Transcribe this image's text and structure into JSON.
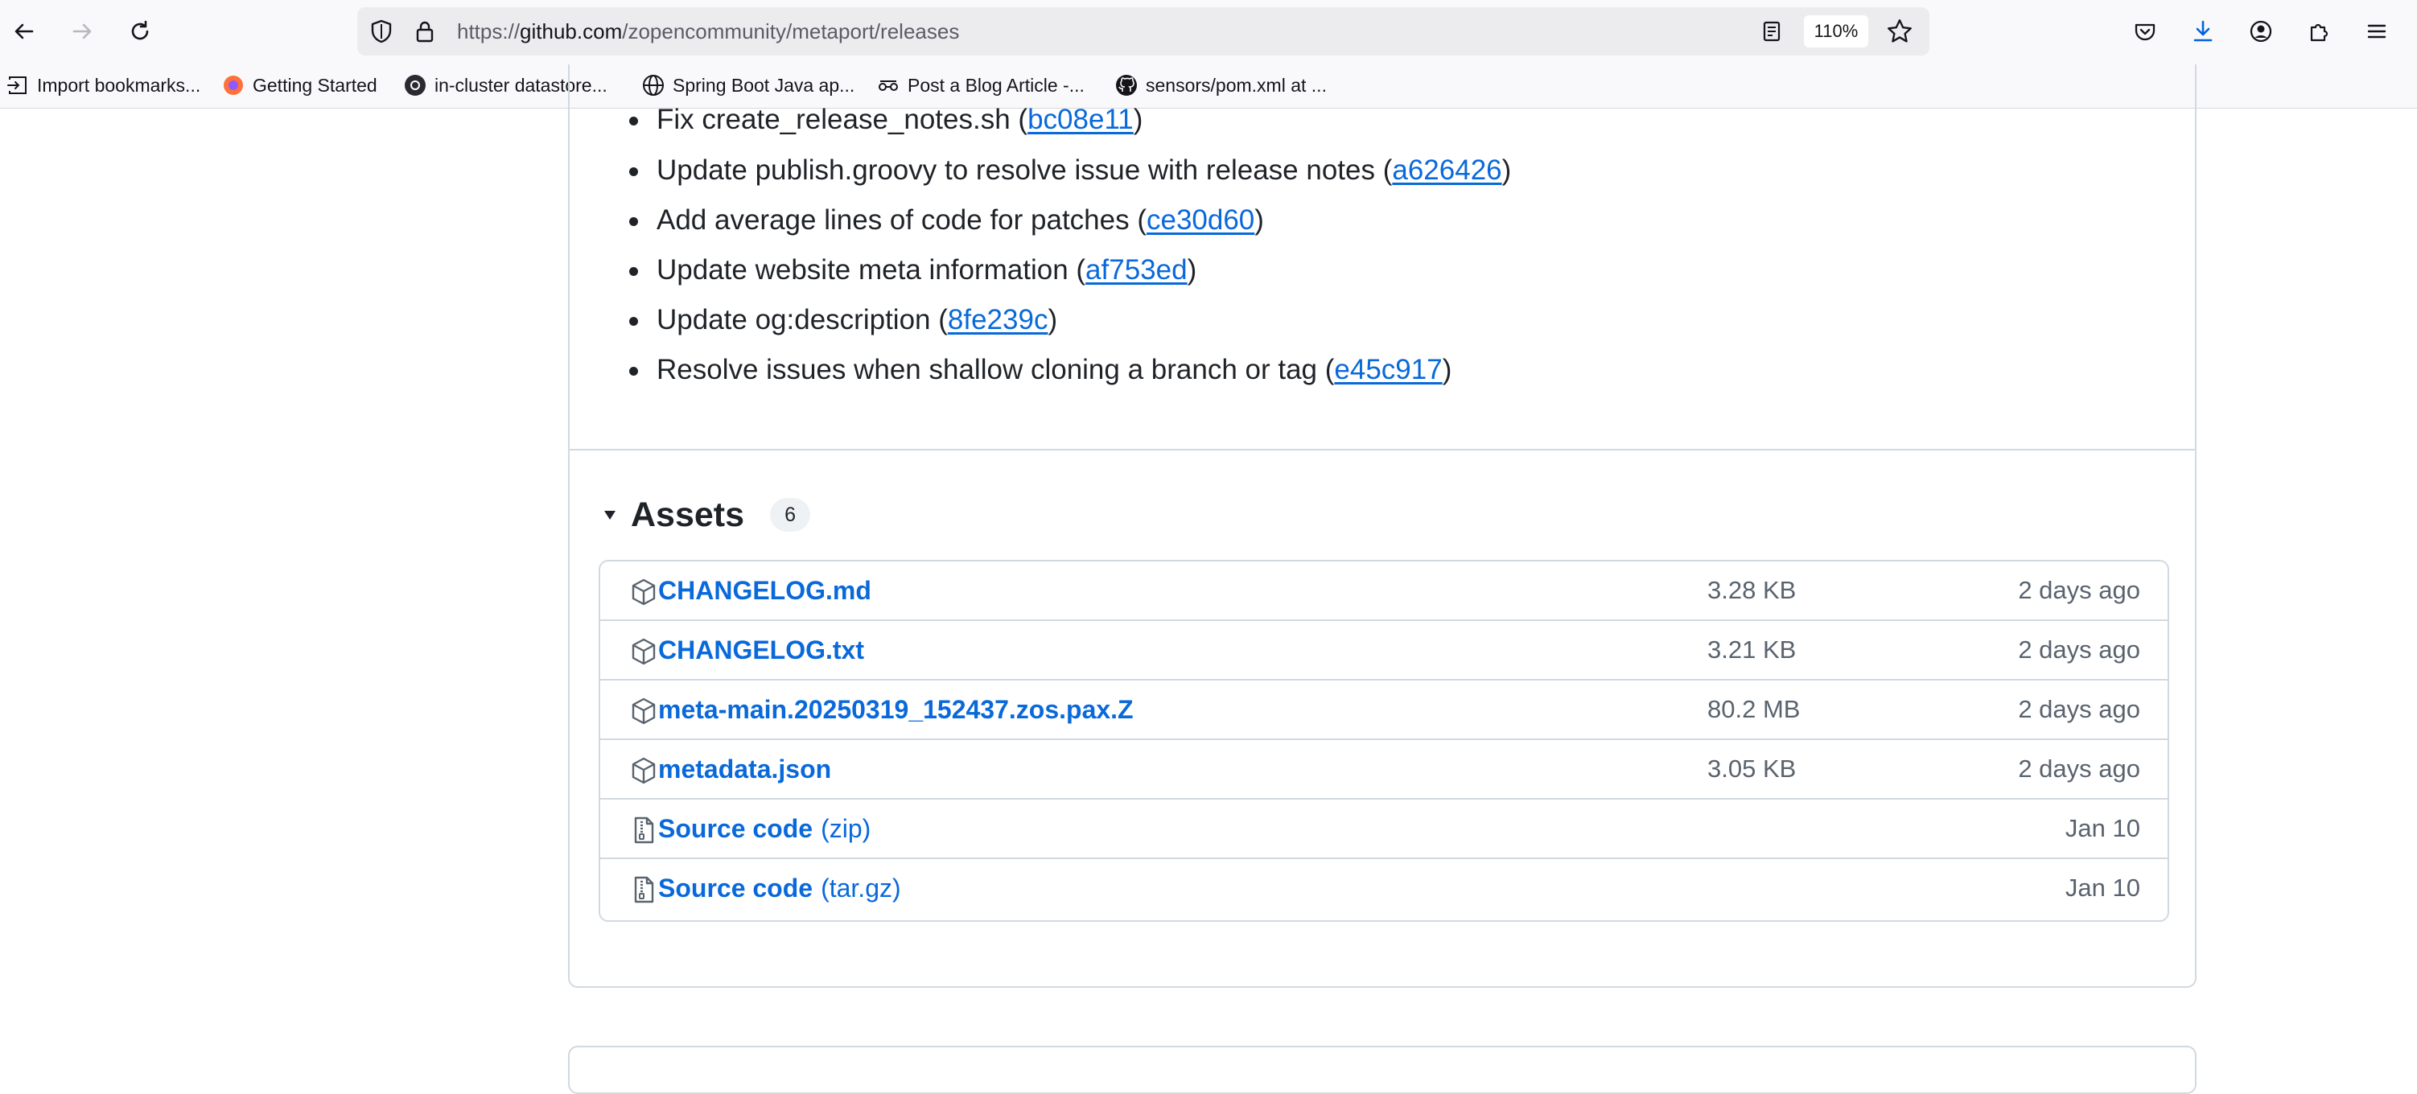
{
  "browser": {
    "url_prefix": "https://",
    "url_domain": "github.com",
    "url_path": "/zopencommunity/metaport/releases",
    "zoom": "110%"
  },
  "bookmarks": [
    {
      "label": "Import bookmarks...",
      "icon": "import-icon"
    },
    {
      "label": "Getting Started",
      "icon": "firefox-icon"
    },
    {
      "label": "in-cluster datastore...",
      "icon": "k8s-icon"
    },
    {
      "label": "Spring Boot Java ap...",
      "icon": "globe-icon"
    },
    {
      "label": "Post a Blog Article -...",
      "icon": "blog-icon"
    },
    {
      "label": "sensors/pom.xml at ...",
      "icon": "github-icon"
    }
  ],
  "notes": [
    {
      "text": "Fix create_release_notes.sh (",
      "commit": "bc08e11",
      "close": ")"
    },
    {
      "text": "Update publish.groovy to resolve issue with release notes (",
      "commit": "a626426",
      "close": ")"
    },
    {
      "text": "Add average lines of code for patches (",
      "commit": "ce30d60",
      "close": ")"
    },
    {
      "text": "Update website meta information (",
      "commit": "af753ed",
      "close": ")"
    },
    {
      "text": "Update og:description (",
      "commit": "8fe239c",
      "close": ")"
    },
    {
      "text": "Resolve issues when shallow cloning a branch or tag (",
      "commit": "e45c917",
      "close": ")"
    }
  ],
  "assets": {
    "title": "Assets",
    "count": "6",
    "rows": [
      {
        "name": "CHANGELOG.md",
        "suffix": "",
        "size": "3.28 KB",
        "date": "2 days ago",
        "icon": "package-icon"
      },
      {
        "name": "CHANGELOG.txt",
        "suffix": "",
        "size": "3.21 KB",
        "date": "2 days ago",
        "icon": "package-icon"
      },
      {
        "name": "meta-main.20250319_152437.zos.pax.Z",
        "suffix": "",
        "size": "80.2 MB",
        "date": "2 days ago",
        "icon": "package-icon"
      },
      {
        "name": "metadata.json",
        "suffix": "",
        "size": "3.05 KB",
        "date": "2 days ago",
        "icon": "package-icon"
      },
      {
        "name": "Source code",
        "suffix": "(zip)",
        "size": "",
        "date": "Jan 10",
        "icon": "file-zip-icon"
      },
      {
        "name": "Source code",
        "suffix": "(tar.gz)",
        "size": "",
        "date": "Jan 10",
        "icon": "file-zip-icon"
      }
    ]
  },
  "colors": {
    "link": "#0969da",
    "border": "#d1d9e0",
    "muted": "#59636e"
  }
}
